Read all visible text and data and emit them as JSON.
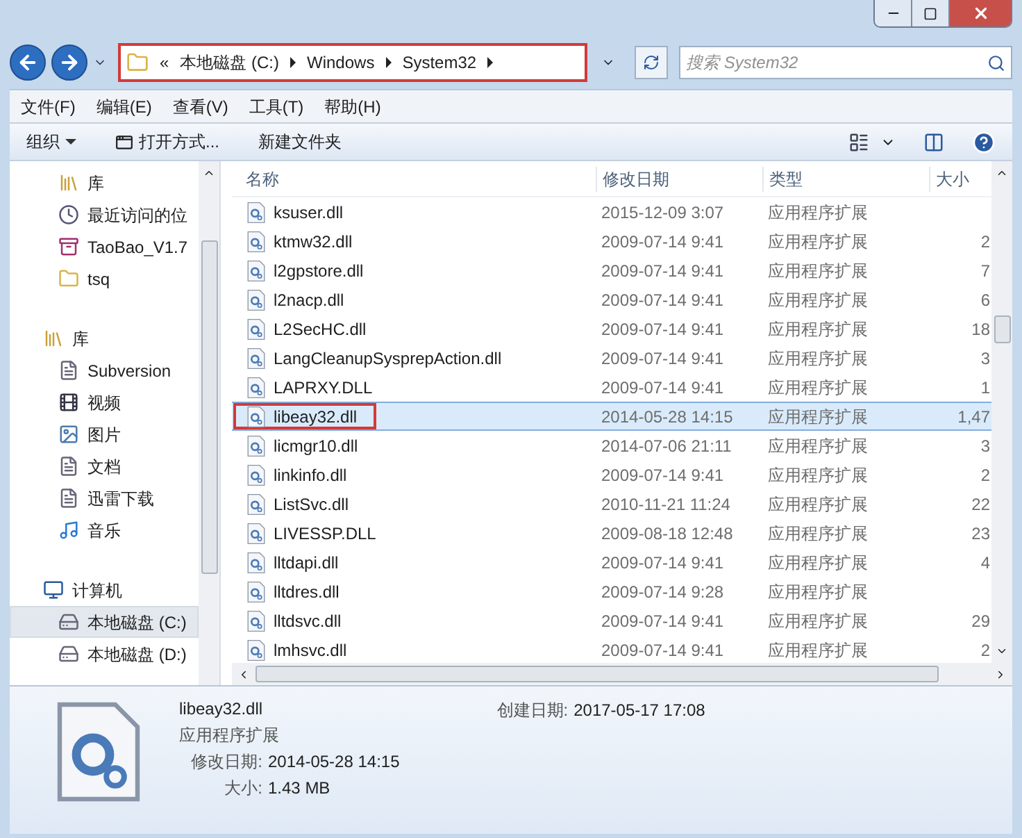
{
  "address": {
    "crumbs": [
      "«",
      "本地磁盘 (C:)",
      "Windows",
      "System32"
    ]
  },
  "search": {
    "placeholder": "搜索 System32"
  },
  "menu": [
    "文件(F)",
    "编辑(E)",
    "查看(V)",
    "工具(T)",
    "帮助(H)"
  ],
  "toolbar": {
    "organize": "组织",
    "open_with": "打开方式...",
    "new_folder": "新建文件夹"
  },
  "sidebar": {
    "items": [
      {
        "label": "库",
        "kind": "library",
        "selected": false
      },
      {
        "label": "最近访问的位",
        "kind": "recent",
        "selected": false
      },
      {
        "label": "TaoBao_V1.7",
        "kind": "archive",
        "selected": false
      },
      {
        "label": "tsq",
        "kind": "folder",
        "selected": false
      }
    ],
    "groups": [
      {
        "label": "库",
        "kind": "library",
        "children": [
          {
            "label": "Subversion",
            "kind": "doc",
            "selected": false
          },
          {
            "label": "视频",
            "kind": "video",
            "selected": false
          },
          {
            "label": "图片",
            "kind": "image",
            "selected": false
          },
          {
            "label": "文档",
            "kind": "doc",
            "selected": false
          },
          {
            "label": "迅雷下载",
            "kind": "doc",
            "selected": false
          },
          {
            "label": "音乐",
            "kind": "music",
            "selected": false
          }
        ]
      },
      {
        "label": "计算机",
        "kind": "computer",
        "children": [
          {
            "label": "本地磁盘 (C:)",
            "kind": "drive",
            "selected": true
          },
          {
            "label": "本地磁盘 (D:)",
            "kind": "drive",
            "selected": false
          }
        ]
      }
    ]
  },
  "table": {
    "columns": [
      "名称",
      "修改日期",
      "类型",
      "大小"
    ],
    "rows": [
      {
        "name": "ksuser.dll",
        "date": "2015-12-09 3:07",
        "type": "应用程序扩展",
        "selected": false
      },
      {
        "name": "ktmw32.dll",
        "date": "2009-07-14 9:41",
        "type": "应用程序扩展",
        "size": "2",
        "selected": false
      },
      {
        "name": "l2gpstore.dll",
        "date": "2009-07-14 9:41",
        "type": "应用程序扩展",
        "size": "7",
        "selected": false
      },
      {
        "name": "l2nacp.dll",
        "date": "2009-07-14 9:41",
        "type": "应用程序扩展",
        "size": "6",
        "selected": false
      },
      {
        "name": "L2SecHC.dll",
        "date": "2009-07-14 9:41",
        "type": "应用程序扩展",
        "size": "18",
        "selected": false
      },
      {
        "name": "LangCleanupSysprepAction.dll",
        "date": "2009-07-14 9:41",
        "type": "应用程序扩展",
        "size": "3",
        "selected": false
      },
      {
        "name": "LAPRXY.DLL",
        "date": "2009-07-14 9:41",
        "type": "应用程序扩展",
        "size": "1",
        "selected": false
      },
      {
        "name": "libeay32.dll",
        "date": "2014-05-28 14:15",
        "type": "应用程序扩展",
        "size": "1,47",
        "selected": true
      },
      {
        "name": "licmgr10.dll",
        "date": "2014-07-06 21:11",
        "type": "应用程序扩展",
        "size": "3",
        "selected": false
      },
      {
        "name": "linkinfo.dll",
        "date": "2009-07-14 9:41",
        "type": "应用程序扩展",
        "size": "2",
        "selected": false
      },
      {
        "name": "ListSvc.dll",
        "date": "2010-11-21 11:24",
        "type": "应用程序扩展",
        "size": "22",
        "selected": false
      },
      {
        "name": "LIVESSP.DLL",
        "date": "2009-08-18 12:48",
        "type": "应用程序扩展",
        "size": "23",
        "selected": false
      },
      {
        "name": "lltdapi.dll",
        "date": "2009-07-14 9:41",
        "type": "应用程序扩展",
        "size": "4",
        "selected": false
      },
      {
        "name": "lltdres.dll",
        "date": "2009-07-14 9:28",
        "type": "应用程序扩展",
        "selected": false
      },
      {
        "name": "lltdsvc.dll",
        "date": "2009-07-14 9:41",
        "type": "应用程序扩展",
        "size": "29",
        "selected": false
      },
      {
        "name": "lmhsvc.dll",
        "date": "2009-07-14 9:41",
        "type": "应用程序扩展",
        "size": "2",
        "selected": false
      }
    ]
  },
  "details": {
    "name": "libeay32.dll",
    "type": "应用程序扩展",
    "modified_label": "修改日期:",
    "modified": "2014-05-28 14:15",
    "size_label": "大小:",
    "size": "1.43 MB",
    "created_label": "创建日期:",
    "created": "2017-05-17 17:08"
  }
}
